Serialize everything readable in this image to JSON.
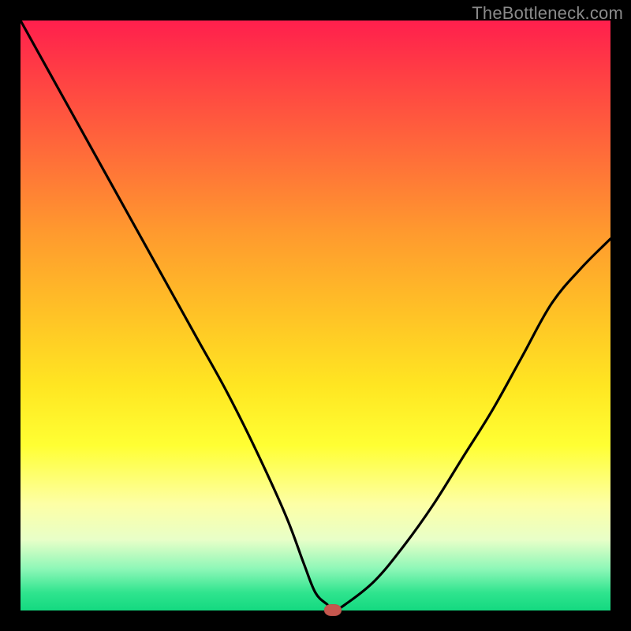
{
  "watermark": "TheBottleneck.com",
  "chart_data": {
    "type": "line",
    "title": "",
    "xlabel": "",
    "ylabel": "",
    "xlim": [
      0,
      100
    ],
    "ylim": [
      0,
      100
    ],
    "grid": false,
    "legend": false,
    "series": [
      {
        "name": "bottleneck-curve",
        "x": [
          0,
          5,
          10,
          15,
          20,
          25,
          30,
          35,
          40,
          45,
          48,
          50,
          52,
          53,
          55,
          60,
          65,
          70,
          75,
          80,
          85,
          90,
          95,
          100
        ],
        "y": [
          100,
          91,
          82,
          73,
          64,
          55,
          46,
          37,
          27,
          16,
          8,
          3,
          1,
          0,
          1,
          5,
          11,
          18,
          26,
          34,
          43,
          52,
          58,
          63
        ]
      }
    ],
    "marker": {
      "x": 53,
      "y": 0,
      "color": "#c5574e"
    },
    "background_gradient": {
      "top": "#ff1f4d",
      "mid": "#ffe622",
      "bottom": "#14d980"
    }
  }
}
